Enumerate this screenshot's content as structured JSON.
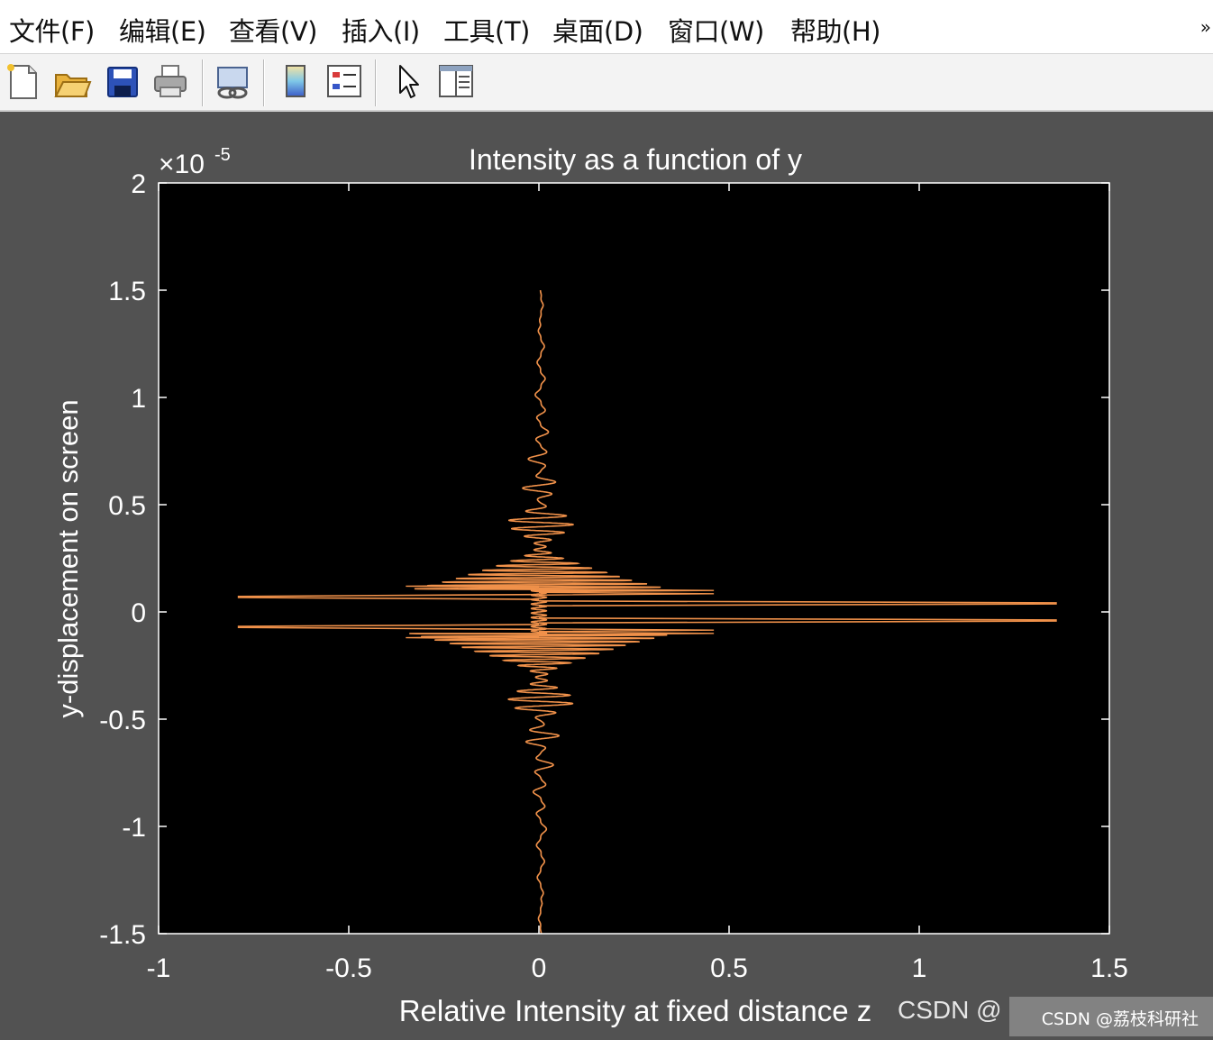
{
  "menu": [
    {
      "label": "文件(F)"
    },
    {
      "label": "编辑(E)"
    },
    {
      "label": "查看(V)"
    },
    {
      "label": "插入(I)"
    },
    {
      "label": "工具(T)"
    },
    {
      "label": "桌面(D)"
    },
    {
      "label": "窗口(W)"
    },
    {
      "label": "帮助(H)"
    }
  ],
  "menu_more": "»",
  "toolbar": {
    "buttons": [
      {
        "icon": "new-figure-icon"
      },
      {
        "icon": "open-file-icon"
      },
      {
        "icon": "save-icon"
      },
      {
        "icon": "print-icon"
      },
      {
        "icon": "link-plot-icon"
      },
      {
        "icon": "insert-colorbar-icon"
      },
      {
        "icon": "insert-legend-icon"
      },
      {
        "icon": "edit-plot-pointer-icon"
      },
      {
        "icon": "property-inspector-icon"
      }
    ]
  },
  "colors": {
    "figure_bg": "#525252",
    "axes_bg": "#000000",
    "axes_fg": "#ffffff",
    "line": "#f0914a"
  },
  "chart_data": {
    "type": "line",
    "title": "Intensity as a function of y",
    "xlabel": "Relative Intensity at fixed distance z",
    "ylabel": "y-displacement on screen",
    "ylabel_exponent_base": "×10",
    "ylabel_exponent": "-5",
    "xlim": [
      -1,
      1.5
    ],
    "ylim": [
      -1.5,
      2
    ],
    "xticks": [
      "-1",
      "-0.5",
      "0",
      "0.5",
      "1",
      "1.5"
    ],
    "yticks": [
      "-1.5",
      "-1",
      "-0.5",
      "0",
      "0.5",
      "1",
      "1.5",
      "2"
    ],
    "grid": false,
    "series": [
      {
        "description_envelope": "oscillating intensity around 0 with symmetric envelope about y=0",
        "y_range": [
          -1.5,
          1.5
        ],
        "peak_right": {
          "x": 1.36,
          "y": [
            0.04,
            -0.04
          ]
        },
        "peak_left": {
          "x": -0.79,
          "y": [
            0.07,
            -0.07
          ]
        },
        "envelope_points": [
          {
            "y": 1.5,
            "amp": 0.005
          },
          {
            "y": 1.2,
            "amp": 0.01
          },
          {
            "y": 1.0,
            "amp": 0.015
          },
          {
            "y": 0.8,
            "amp": 0.025
          },
          {
            "y": 0.6,
            "amp": 0.045
          },
          {
            "y": 0.5,
            "amp": 0.07
          },
          {
            "y": 0.4,
            "amp": 0.09
          },
          {
            "y": 0.3,
            "amp": 0.14
          },
          {
            "y": 0.2,
            "amp": 0.2
          },
          {
            "y": 0.15,
            "amp": 0.25
          },
          {
            "y": 0.1,
            "amp": 0.35
          }
        ]
      }
    ]
  },
  "watermark": "CSDN @荔枝科研社",
  "watermark_partial": "CSDN @"
}
